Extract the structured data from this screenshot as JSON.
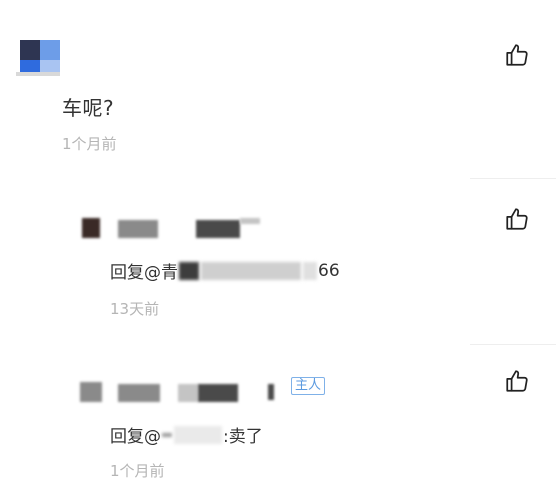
{
  "comment": {
    "text": "车呢?",
    "time": "1个月前",
    "like_icon": "thumbs-up-icon"
  },
  "replies": [
    {
      "prefix": "回复@青",
      "suffix": "66",
      "time": "13天前",
      "like_icon": "thumbs-up-icon"
    },
    {
      "prefix": "回复@",
      "suffix": ":卖了",
      "badge": "主人",
      "time": "1个月前",
      "like_icon": "thumbs-up-icon"
    }
  ]
}
